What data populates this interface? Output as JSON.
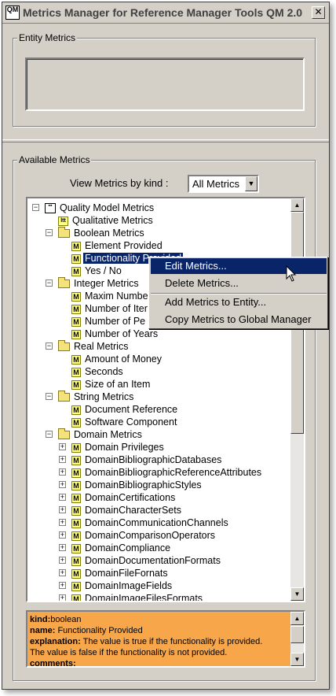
{
  "window": {
    "title": "Metrics Manager for Reference Manager Tools QM 2.0",
    "icon_glyph": "QM",
    "close_glyph": "✕"
  },
  "entity_panel": {
    "legend": "Entity Metrics"
  },
  "available_panel": {
    "legend": "Available Metrics",
    "view_label": "View Metrics by kind :",
    "view_value": "All Metrics"
  },
  "tree": [
    {
      "label": "Quality Model Metrics",
      "level": 0,
      "icon": "qm-icon",
      "expander": "-"
    },
    {
      "label": "Qualitative Metrics",
      "level": 1,
      "icon": "qualitative-icon",
      "expander": ""
    },
    {
      "label": "Boolean Metrics",
      "level": 1,
      "icon": "folder-icon",
      "expander": "-"
    },
    {
      "label": "Element Provided",
      "level": 2,
      "icon": "metric-icon",
      "expander": ""
    },
    {
      "label": "Functionality Provided",
      "level": 2,
      "icon": "metric-icon",
      "expander": "",
      "selected": true
    },
    {
      "label": "Yes / No",
      "level": 2,
      "icon": "metric-icon",
      "expander": ""
    },
    {
      "label": "Integer Metrics",
      "level": 1,
      "icon": "folder-icon",
      "expander": "-"
    },
    {
      "label": "Maxim Numbe",
      "level": 2,
      "icon": "metric-icon",
      "expander": ""
    },
    {
      "label": "Number of Iter",
      "level": 2,
      "icon": "metric-icon",
      "expander": ""
    },
    {
      "label": "Number of Pe",
      "level": 2,
      "icon": "metric-icon",
      "expander": ""
    },
    {
      "label": "Number of Years",
      "level": 2,
      "icon": "metric-icon",
      "expander": ""
    },
    {
      "label": "Real Metrics",
      "level": 1,
      "icon": "folder-icon",
      "expander": "-"
    },
    {
      "label": "Amount of Money",
      "level": 2,
      "icon": "metric-icon",
      "expander": ""
    },
    {
      "label": "Seconds",
      "level": 2,
      "icon": "metric-icon",
      "expander": ""
    },
    {
      "label": "Size of an Item",
      "level": 2,
      "icon": "metric-icon",
      "expander": ""
    },
    {
      "label": "String Metrics",
      "level": 1,
      "icon": "folder-icon",
      "expander": "-"
    },
    {
      "label": "Document Reference",
      "level": 2,
      "icon": "metric-icon",
      "expander": ""
    },
    {
      "label": "Software Component",
      "level": 2,
      "icon": "metric-icon",
      "expander": ""
    },
    {
      "label": "Domain Metrics",
      "level": 1,
      "icon": "folder-icon",
      "expander": "-"
    },
    {
      "label": "Domain Privileges",
      "level": 2,
      "icon": "metric-icon",
      "expander": "+"
    },
    {
      "label": "DomainBibliographicDatabases",
      "level": 2,
      "icon": "metric-icon",
      "expander": "+"
    },
    {
      "label": "DomainBibliographicReferenceAttributes",
      "level": 2,
      "icon": "metric-icon",
      "expander": "+"
    },
    {
      "label": "DomainBibliographicStyles",
      "level": 2,
      "icon": "metric-icon",
      "expander": "+"
    },
    {
      "label": "DomainCertifications",
      "level": 2,
      "icon": "metric-icon",
      "expander": "+"
    },
    {
      "label": "DomainCharacterSets",
      "level": 2,
      "icon": "metric-icon",
      "expander": "+"
    },
    {
      "label": "DomainCommunicationChannels",
      "level": 2,
      "icon": "metric-icon",
      "expander": "+"
    },
    {
      "label": "DomainComparisonOperators",
      "level": 2,
      "icon": "metric-icon",
      "expander": "+"
    },
    {
      "label": "DomainCompliance",
      "level": 2,
      "icon": "metric-icon",
      "expander": "+"
    },
    {
      "label": "DomainDocumentationFormats",
      "level": 2,
      "icon": "metric-icon",
      "expander": "+"
    },
    {
      "label": "DomainFileFornats",
      "level": 2,
      "icon": "metric-icon",
      "expander": "+"
    },
    {
      "label": "DomainImageFields",
      "level": 2,
      "icon": "metric-icon",
      "expander": "+"
    },
    {
      "label": "DomainImageFilesFormats",
      "level": 2,
      "icon": "metric-icon",
      "expander": "+"
    }
  ],
  "context_menu": [
    {
      "label": "Edit Metrics...",
      "active": true
    },
    {
      "label": "Delete Metrics...",
      "active": false
    },
    {
      "label": "Add Metrics to Entity...",
      "active": false
    },
    {
      "label": "Copy Metrics to Global Manager",
      "active": false
    }
  ],
  "description": {
    "kind_key": "kind:",
    "kind_value": "boolean",
    "name_key": "name:",
    "name_value": " Functionality Provided",
    "explanation_key": "explanation:",
    "explanation_value": " The value is true if the functionality is provided.",
    "explanation_value2": "The value is false if the functionality is not provided.",
    "comments_key": "comments:"
  },
  "colors": {
    "window_bg": "#d4d0c8",
    "selection": "#0a246a",
    "description_bg": "#f7a64a"
  }
}
